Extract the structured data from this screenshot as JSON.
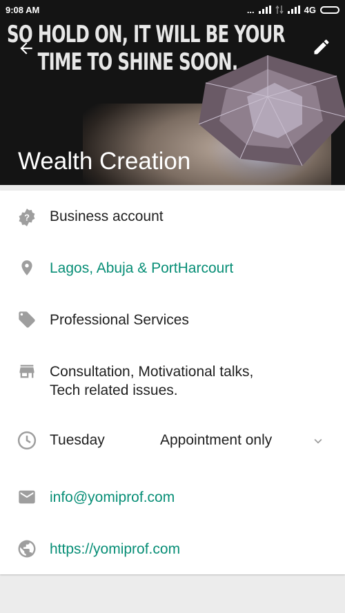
{
  "status_bar": {
    "time": "9:08 AM",
    "dots": "...",
    "network": "4G"
  },
  "header": {
    "quote_line1": "SO HOLD ON, IT WILL BE YOUR",
    "quote_line2": "TIME TO SHINE SOON.",
    "title": "Wealth Creation"
  },
  "details": {
    "account_type": "Business account",
    "location": "Lagos, Abuja & PortHarcourt",
    "category": "Professional Services",
    "description_line1": "Consultation, Motivational talks,",
    "description_line2": "Tech related issues.",
    "hours_day": "Tuesday",
    "hours_value": "Appointment only",
    "email": "info@yomiprof.com",
    "website": "https://yomiprof.com"
  },
  "colors": {
    "accent": "#078e76",
    "icon_gray": "#9e9e9e"
  }
}
